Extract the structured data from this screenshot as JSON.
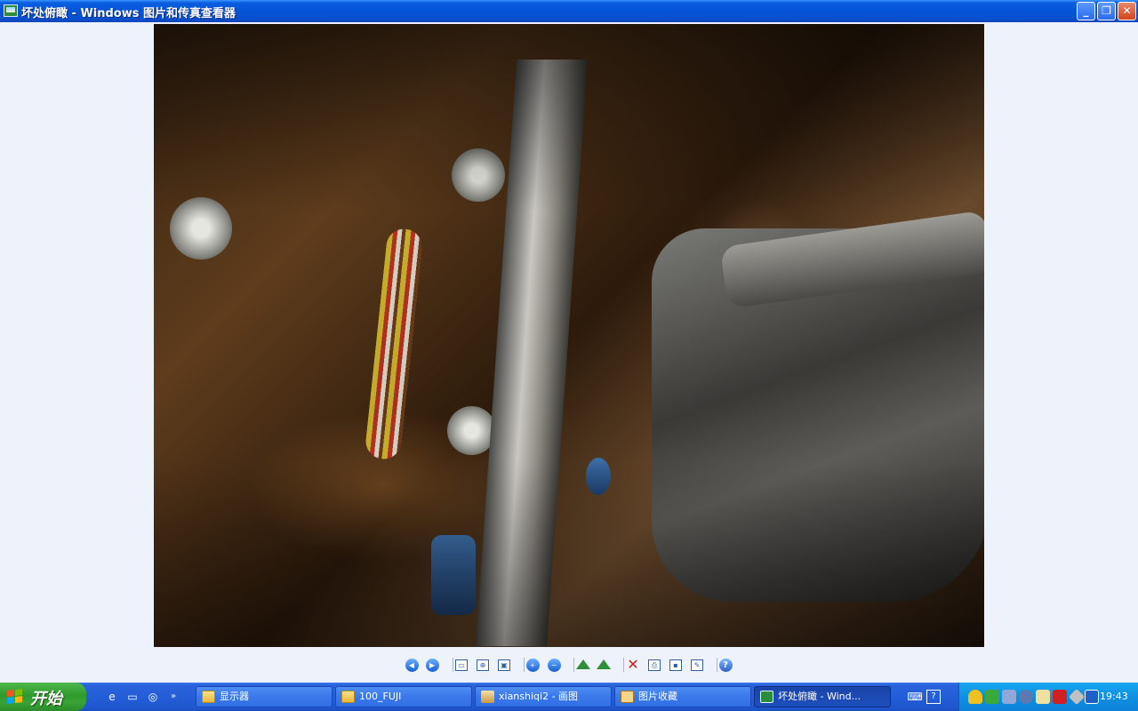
{
  "window": {
    "title": "坏处俯瞰 - Windows 图片和传真查看器",
    "minimize_glyph": "_",
    "maximize_glyph": "❐",
    "close_glyph": "✕"
  },
  "toolbar": {
    "prev": "◀",
    "next": "▶",
    "best_fit": "▭",
    "actual_size": "⊕",
    "slideshow": "▣",
    "zoom_in": "+",
    "zoom_out": "−",
    "rotate_cw": "",
    "rotate_ccw": "",
    "delete": "✕",
    "print": "⎙",
    "save": "▪",
    "edit": "✎",
    "help": "?"
  },
  "taskbar": {
    "start_label": "开始",
    "quicklaunch": [
      "e",
      "▭",
      "◎",
      "»"
    ],
    "tasks": [
      {
        "label": "显示器",
        "icon": "folder-icon"
      },
      {
        "label": "100_FUJI",
        "icon": "folder-icon"
      },
      {
        "label": "xianshiqi2 - 画图",
        "icon": "paint-icon"
      },
      {
        "label": "图片收藏",
        "icon": "favorites-icon"
      },
      {
        "label": "坏处俯瞰 - Wind...",
        "icon": "viewer-icon"
      }
    ],
    "misc": [
      "⌨",
      "?"
    ],
    "clock": "19:43"
  },
  "colors": {
    "titlebar": "#0553d6",
    "taskbar": "#245ed8",
    "start": "#2e9b2c",
    "tray": "#0f8fe0",
    "viewer_bg": "#eef3fb"
  }
}
